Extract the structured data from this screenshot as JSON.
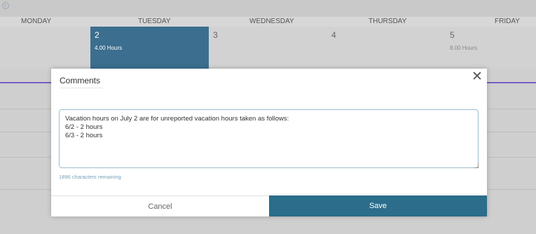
{
  "calendar": {
    "days": [
      {
        "name": "MONDAY"
      },
      {
        "name": "TUESDAY"
      },
      {
        "name": "WEDNESDAY"
      },
      {
        "name": "THURSDAY"
      },
      {
        "name": "FRIDAY"
      }
    ],
    "cells": [
      {
        "num": "2",
        "hours": "4.00 Hours",
        "selected": true
      },
      {
        "num": "3",
        "hours": ""
      },
      {
        "num": "4",
        "hours": ""
      },
      {
        "num": "5",
        "hours": "8.00 Hours"
      }
    ],
    "colors": {
      "selected": "#3b6e8f",
      "accent_line": "#7a5fbf"
    }
  },
  "modal": {
    "title": "Comments",
    "comment_text": "Vacation hours on July 2 are for unreported vacation hours taken as follows:\n6/2 - 2 hours\n6/3 - 2 hours",
    "chars_remaining": "1896 characters remaining",
    "cancel_label": "Cancel",
    "save_label": "Save",
    "close_symbol": "✕",
    "colors": {
      "save_bg": "#2b6d8b",
      "textarea_border": "#9cbcd0"
    }
  }
}
